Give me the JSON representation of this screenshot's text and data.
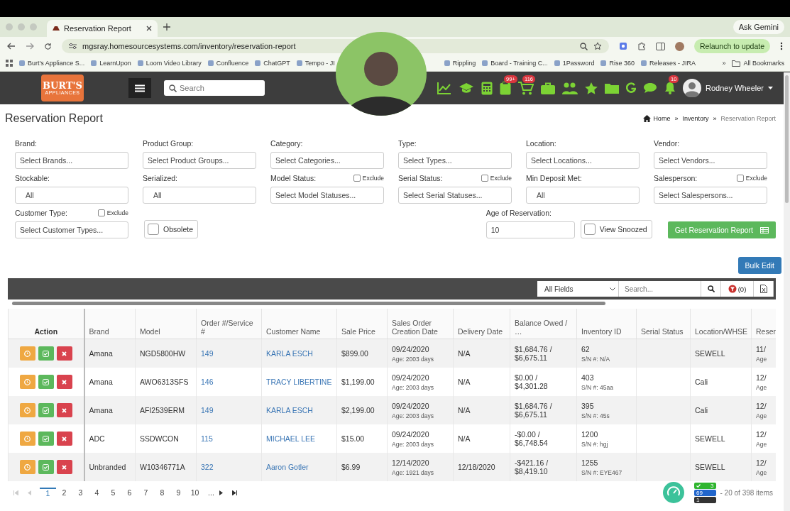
{
  "browser": {
    "tab_title": "Reservation Report",
    "ask_gemini": "Ask Gemini",
    "url": "mgsray.homesourcesystems.com/inventory/reservation-report",
    "relaunch": "Relaunch to update",
    "bookmarks": [
      {
        "label": "Burt's Appliance S..."
      },
      {
        "label": "LearnUpon"
      },
      {
        "label": "Loom Video Library"
      },
      {
        "label": "Confluence"
      },
      {
        "label": "ChatGPT"
      },
      {
        "label": "Tempo - JI"
      }
    ],
    "bookmarks_right": [
      {
        "label": "Rippling"
      },
      {
        "label": "Board - Training C..."
      },
      {
        "label": "1Password"
      },
      {
        "label": "Rise 360"
      },
      {
        "label": "Releases - JIRA"
      }
    ],
    "more": "»",
    "all_bookmarks": "All Bookmarks"
  },
  "header": {
    "logo_title": "BURT'S",
    "logo_subtitle": "APPLIANCES",
    "search_placeholder": "Search",
    "clipboard_badge": "99+",
    "cart_badge": "116",
    "bell_badge": "10",
    "user_name": "Rodney Wheeler"
  },
  "page": {
    "title": "Reservation Report",
    "breadcrumb": [
      {
        "kind": "home",
        "label": "Home"
      },
      {
        "kind": "sep",
        "label": "»"
      },
      {
        "kind": "link",
        "label": "Inventory"
      },
      {
        "kind": "sep",
        "label": "»"
      },
      {
        "kind": "current",
        "label": "Reservation Report"
      }
    ]
  },
  "filters": [
    {
      "label": "Brand:",
      "kind": "multi",
      "placeholder": "Select Brands..."
    },
    {
      "label": "Product Group:",
      "kind": "multi",
      "placeholder": "Select Product Groups..."
    },
    {
      "label": "Category:",
      "kind": "multi",
      "placeholder": "Select Categories..."
    },
    {
      "label": "Type:",
      "kind": "multi",
      "placeholder": "Select Types..."
    },
    {
      "label": "Location:",
      "kind": "multi",
      "placeholder": "Select Locations..."
    },
    {
      "label": "Vendor:",
      "kind": "multi",
      "placeholder": "Select Vendors..."
    },
    {
      "label": "Stockable:",
      "kind": "single",
      "value": "All"
    },
    {
      "label": "Serialized:",
      "kind": "single",
      "value": "All"
    },
    {
      "label": "Model Status:",
      "kind": "multi",
      "placeholder": "Select Model Statuses...",
      "exclude_label": "Exclude",
      "exclude_checked": false
    },
    {
      "label": "Serial Status:",
      "kind": "multi",
      "placeholder": "Select Serial Statuses...",
      "exclude_label": "Exclude",
      "exclude_checked": false
    },
    {
      "label": "Min Deposit Met:",
      "kind": "single",
      "value": "All"
    },
    {
      "label": "Salesperson:",
      "kind": "multi",
      "placeholder": "Select Salespersons...",
      "exclude_label": "Exclude",
      "exclude_checked": false
    }
  ],
  "options_row": {
    "customer_type": {
      "label": "Customer Type:",
      "placeholder": "Select Customer Types...",
      "exclude_label": "Exclude",
      "exclude_checked": false
    },
    "obsolete": {
      "label": "Obsolete",
      "checked": false
    },
    "age": {
      "label": "Age of Reservation:",
      "value": "10"
    },
    "view_snoozed": {
      "label": "View Snoozed",
      "checked": false
    },
    "report_button": "Get Reservation Report"
  },
  "bulk_edit": "Bulk Edit",
  "toolbar": {
    "field_select": "All Fields",
    "search_placeholder": "Search...",
    "filter_count": "(0)"
  },
  "table": {
    "columns": [
      "Action",
      "Brand",
      "Model",
      "Order #/Service #",
      "Customer Name",
      "Sale Price",
      "Sales Order Creation Date",
      "Delivery Date",
      "Balance Owed / …",
      "Inventory ID",
      "Serial Status",
      "Location/WHSE",
      "Reser"
    ],
    "rows": [
      {
        "brand": "Amana",
        "model": "NGD5800HW",
        "order": "149",
        "customer": "KARLA ESCH",
        "price": "$899.00",
        "so_date": "09/24/2020",
        "so_age": "Age: 2003 days",
        "delivery": "N/A",
        "balance": "$1,684.76 / $6,675.11",
        "inventory_id": "62",
        "serial_number": "S/N #: N/A",
        "location": "SEWELL",
        "reservation": "11/",
        "reservation_age": "Age"
      },
      {
        "brand": "Amana",
        "model": "AWO6313SFS",
        "order": "146",
        "customer": "TRACY LIBERTINE",
        "price": "$1,199.00",
        "so_date": "09/24/2020",
        "so_age": "Age: 2003 days",
        "delivery": "N/A",
        "balance": "$0.00 / $4,301.28",
        "inventory_id": "403",
        "serial_number": "S/N #: 45aa",
        "location": "Cali",
        "reservation": "12/",
        "reservation_age": "Age"
      },
      {
        "brand": "Amana",
        "model": "AFI2539ERM",
        "order": "149",
        "customer": "KARLA ESCH",
        "price": "$2,199.00",
        "so_date": "09/24/2020",
        "so_age": "Age: 2003 days",
        "delivery": "N/A",
        "balance": "$1,684.76 / $6,675.11",
        "inventory_id": "395",
        "serial_number": "S/N #: 45s",
        "location": "Cali",
        "reservation": "12/",
        "reservation_age": "Age"
      },
      {
        "brand": "ADC",
        "model": "SSDWCON",
        "order": "115",
        "customer": "MICHAEL LEE",
        "price": "$15.00",
        "so_date": "09/24/2020",
        "so_age": "Age: 2003 days",
        "delivery": "N/A",
        "balance": "-$0.00 / $6,748.54",
        "inventory_id": "1200",
        "serial_number": "S/N #: hgj",
        "location": "SEWELL",
        "reservation": "12/",
        "reservation_age": "Age"
      },
      {
        "brand": "Unbranded",
        "model": "W10346771A",
        "order": "322",
        "customer": "Aaron Gotler",
        "price": "$6.99",
        "so_date": "12/14/2020",
        "so_age": "Age: 1921 days",
        "delivery": "12/18/2020",
        "balance": "-$421.16 / $8,419.10",
        "inventory_id": "1255",
        "serial_number": "S/N #: EYE467",
        "location": "SEWELL",
        "reservation": "12/",
        "reservation_age": "Age"
      }
    ]
  },
  "pagination": {
    "pages": [
      {
        "label": "1",
        "selected": true
      },
      {
        "label": "2",
        "selected": false
      },
      {
        "label": "3",
        "selected": false
      },
      {
        "label": "4",
        "selected": false
      },
      {
        "label": "5",
        "selected": false
      },
      {
        "label": "6",
        "selected": false
      },
      {
        "label": "7",
        "selected": false
      },
      {
        "label": "8",
        "selected": false
      },
      {
        "label": "9",
        "selected": false
      },
      {
        "label": "10",
        "selected": false
      },
      {
        "label": "...",
        "selected": false
      }
    ],
    "info": "- 20 of 398 items"
  },
  "widget": {
    "tasks": "3",
    "calls": "69",
    "messages": "1"
  }
}
